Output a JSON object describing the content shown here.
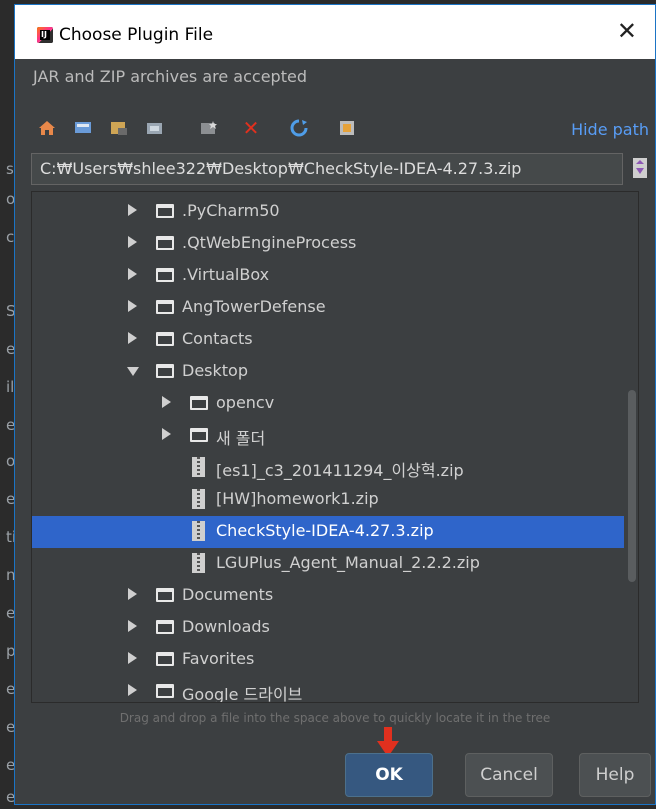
{
  "dialog": {
    "title": "Choose Plugin File",
    "close_label": "✕",
    "info_text": "JAR and ZIP archives are accepted",
    "hide_path_label": "Hide path",
    "path_value": "C:₩Users₩shlee322₩Desktop₩CheckStyle-IDEA-4.27.3.zip",
    "hint": "Drag and drop a file into the space above to quickly locate it in the tree",
    "buttons": {
      "ok": "OK",
      "cancel": "Cancel",
      "help": "Help"
    },
    "toolbar_icons": [
      "home-icon",
      "desktop-icon",
      "project-icon",
      "module-icon",
      "new-folder-icon",
      "delete-icon",
      "refresh-icon",
      "show-hidden-icon"
    ]
  },
  "tree": {
    "items": [
      {
        "label": ".PyCharm50",
        "type": "folder",
        "expanded": false,
        "depth": 1
      },
      {
        "label": ".QtWebEngineProcess",
        "type": "folder",
        "expanded": false,
        "depth": 1
      },
      {
        "label": ".VirtualBox",
        "type": "folder",
        "expanded": false,
        "depth": 1
      },
      {
        "label": "AngTowerDefense",
        "type": "folder",
        "expanded": false,
        "depth": 1
      },
      {
        "label": "Contacts",
        "type": "folder",
        "expanded": false,
        "depth": 1
      },
      {
        "label": "Desktop",
        "type": "folder",
        "expanded": true,
        "depth": 1
      },
      {
        "label": "opencv",
        "type": "folder",
        "expanded": false,
        "depth": 2
      },
      {
        "label": "새 폴더",
        "type": "folder",
        "expanded": false,
        "depth": 2
      },
      {
        "label": "[es1]_c3_201411294_이상혁.zip",
        "type": "zip",
        "depth": 2
      },
      {
        "label": "[HW]homework1.zip",
        "type": "zip",
        "depth": 2
      },
      {
        "label": "CheckStyle-IDEA-4.27.3.zip",
        "type": "zip",
        "depth": 2,
        "selected": true
      },
      {
        "label": "LGUPlus_Agent_Manual_2.2.2.zip",
        "type": "zip",
        "depth": 2
      },
      {
        "label": "Documents",
        "type": "folder",
        "expanded": false,
        "depth": 1
      },
      {
        "label": "Downloads",
        "type": "folder",
        "expanded": false,
        "depth": 1
      },
      {
        "label": "Favorites",
        "type": "folder",
        "expanded": false,
        "depth": 1
      },
      {
        "label": "Google 드라이브",
        "type": "folder",
        "expanded": false,
        "depth": 1
      }
    ]
  },
  "background": {
    "fragments": [
      "s",
      "o",
      "c",
      "S",
      "e",
      "il",
      "e",
      "ou",
      "e",
      "ti",
      "n",
      "e",
      "p",
      "e",
      "e",
      "e",
      "e"
    ]
  },
  "colors": {
    "accent": "#2f65ca",
    "link": "#589df6",
    "ok_button": "#365880",
    "pointer": "#e0301e"
  }
}
